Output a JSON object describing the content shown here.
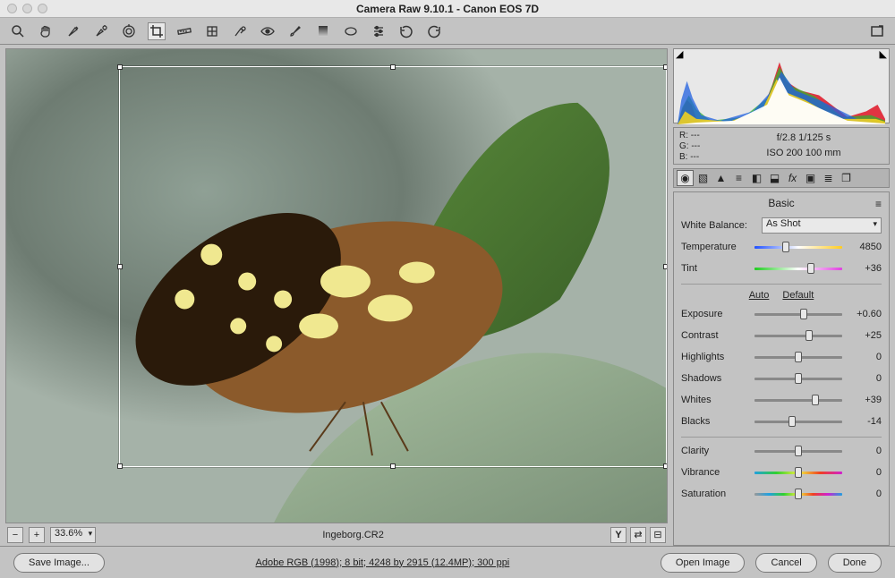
{
  "title": "Camera Raw 9.10.1  -  Canon EOS 7D",
  "zoom": "33.6%",
  "filename": "Ingeborg.CR2",
  "footerInfo": "Adobe RGB (1998); 8 bit; 4248 by 2915 (12.4MP); 300 ppi",
  "buttons": {
    "saveImage": "Save Image...",
    "openImage": "Open Image",
    "cancel": "Cancel",
    "done": "Done"
  },
  "readout": {
    "r": "R:   ---",
    "g": "G:   ---",
    "b": "B:   ---",
    "line1": "f/2.8   1/125 s",
    "line2": "ISO 200   100 mm"
  },
  "panel": {
    "title": "Basic",
    "wbLabel": "White Balance:",
    "wbValue": "As Shot",
    "autoLabel": "Auto",
    "defaultLabel": "Default",
    "sliders": {
      "temperature": {
        "label": "Temperature",
        "value": "4850",
        "pos": 36,
        "gradient": "g-temp"
      },
      "tint": {
        "label": "Tint",
        "value": "+36",
        "pos": 64,
        "gradient": "g-tint"
      },
      "exposure": {
        "label": "Exposure",
        "value": "+0.60",
        "pos": 56
      },
      "contrast": {
        "label": "Contrast",
        "value": "+25",
        "pos": 62
      },
      "highlights": {
        "label": "Highlights",
        "value": "0",
        "pos": 50
      },
      "shadows": {
        "label": "Shadows",
        "value": "0",
        "pos": 50
      },
      "whites": {
        "label": "Whites",
        "value": "+39",
        "pos": 69
      },
      "blacks": {
        "label": "Blacks",
        "value": "-14",
        "pos": 43
      },
      "clarity": {
        "label": "Clarity",
        "value": "0",
        "pos": 50
      },
      "vibrance": {
        "label": "Vibrance",
        "value": "0",
        "pos": 50,
        "gradient": "g-vib"
      },
      "saturation": {
        "label": "Saturation",
        "value": "0",
        "pos": 50,
        "gradient": "g-sat"
      }
    }
  }
}
